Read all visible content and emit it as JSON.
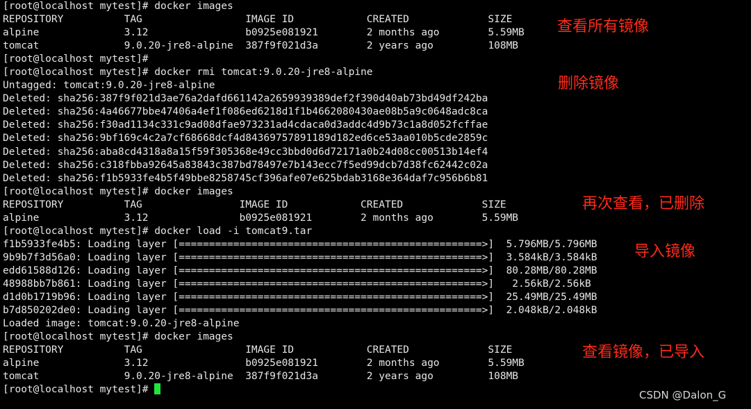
{
  "terminal": {
    "lines": [
      "[root@localhost mytest]# docker images",
      "REPOSITORY          TAG                 IMAGE ID            CREATED             SIZE",
      "alpine              3.12                b0925e081921        2 months ago        5.59MB",
      "tomcat              9.0.20-jre8-alpine  387f9f021d3a        2 years ago         108MB",
      "[root@localhost mytest]#",
      "[root@localhost mytest]# docker rmi tomcat:9.0.20-jre8-alpine",
      "Untagged: tomcat:9.0.20-jre8-alpine",
      "Deleted: sha256:387f9f021d3ae76a2dafd661142a2659939389def2f390d40ab73bd49df242ba",
      "Deleted: sha256:4a46677bbe47406a4ef1f086ed6218d1f1b4662080430ae08b5a9c0648adc8ca",
      "Deleted: sha256:f30ad1134c331c9ad08dfae973231ad4cdaca0d3addc4d9b73c1a8d052fcffae",
      "Deleted: sha256:9bf169c4c2a7cf68668dcf4d84369757891189d182ed6ce53aa010b5cde2859c",
      "Deleted: sha256:aba8cd4318a8a15f59f305368e49cc3bbd0d6d72171a0b24d08cc00513b14ef4",
      "Deleted: sha256:c318fbba92645a83843c387bd78497e7b143ecc7f5ed99dcb7d38fc62442c02a",
      "Deleted: sha256:f1b5933fe4b5f49bbe8258745cf396afe07e625bdab3168e364daf7c956b6b81",
      "[root@localhost mytest]# docker images",
      "REPOSITORY          TAG                IMAGE ID            CREATED             SIZE",
      "alpine              3.12               b0925e081921        2 months ago        5.59MB",
      "[root@localhost mytest]# docker load -i tomcat9.tar",
      "f1b5933fe4b5: Loading layer [==================================================>]  5.796MB/5.796MB",
      "9b9b7f3d56a0: Loading layer [==================================================>]  3.584kB/3.584kB",
      "edd61588d126: Loading layer [==================================================>]  80.28MB/80.28MB",
      "48988bb7b861: Loading layer [==================================================>]   2.56kB/2.56kB",
      "d1d0b1719b96: Loading layer [==================================================>]  25.49MB/25.49MB",
      "b7d850202de0: Loading layer [==================================================>]  2.048kB/2.048kB",
      "Loaded image: tomcat:9.0.20-jre8-alpine",
      "[root@localhost mytest]# docker images",
      "REPOSITORY          TAG                 IMAGE ID            CREATED             SIZE",
      "alpine              3.12                b0925e081921        2 months ago        5.59MB",
      "tomcat              9.0.20-jre8-alpine  387f9f021d3a        2 years ago         108MB",
      "[root@localhost mytest]# "
    ],
    "cursor_color": "#22e33a",
    "text_color": "#e6e6e6",
    "background_color": "#000000"
  },
  "annotations": {
    "list_images": "查看所有镜像",
    "delete_image": "删除镜像",
    "recheck_deleted": "再次查看，已删除",
    "import_image": "导入镜像",
    "verify_imported": "查看镜像，已导入",
    "color": "#ff2a1a"
  },
  "watermark": "CSDN @Dalon_G"
}
